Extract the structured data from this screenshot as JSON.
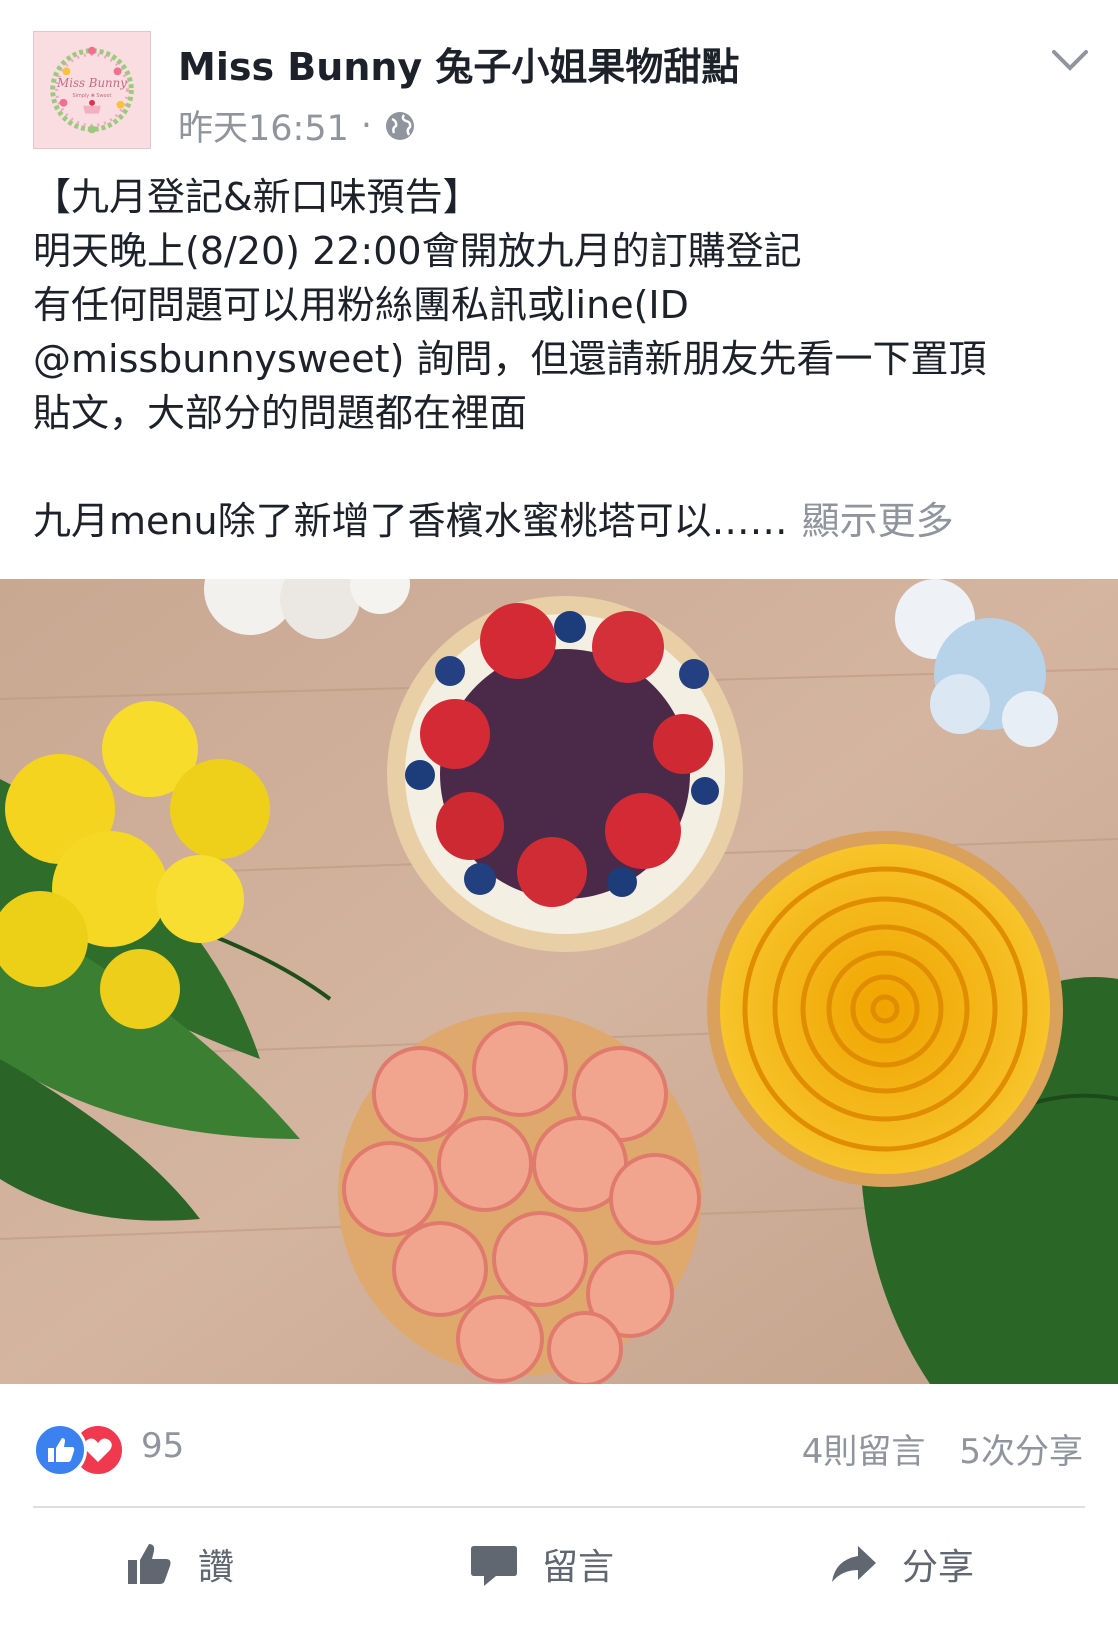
{
  "post": {
    "page_name": "Miss Bunny 兔子小姐果物甜點",
    "time": "昨天16:51",
    "separator": "·",
    "lines": [
      "【九月登記&新口味預告】",
      "明天晚上(8/20) 22:00會開放九月的訂購登記",
      "有任何問題可以用粉絲團私訊或line(ID",
      "@missbunnysweet) 詢問，但還請新朋友先看一下置頂",
      "貼文，大部分的問題都在裡面"
    ],
    "truncated_line": "九月menu除了新增了香檳水蜜桃塔可以……",
    "see_more": "顯示更多",
    "avatar_text": "Miss Bunny",
    "avatar_subtext": "Simply ❀ Sweet"
  },
  "stats": {
    "reaction_count": "95",
    "comments": "4則留言",
    "shares": "5次分享"
  },
  "actions": {
    "like": "讚",
    "comment": "留言",
    "share": "分享"
  },
  "icons": [
    "chevron-down-icon",
    "globe-icon",
    "like-reaction-icon",
    "love-reaction-icon",
    "thumbs-up-icon",
    "comment-bubble-icon",
    "share-arrow-icon"
  ],
  "colors": {
    "like_blue": "#3b82f0",
    "love_red": "#f0384f",
    "muted_text": "#90949c",
    "action_gray": "#606770"
  }
}
